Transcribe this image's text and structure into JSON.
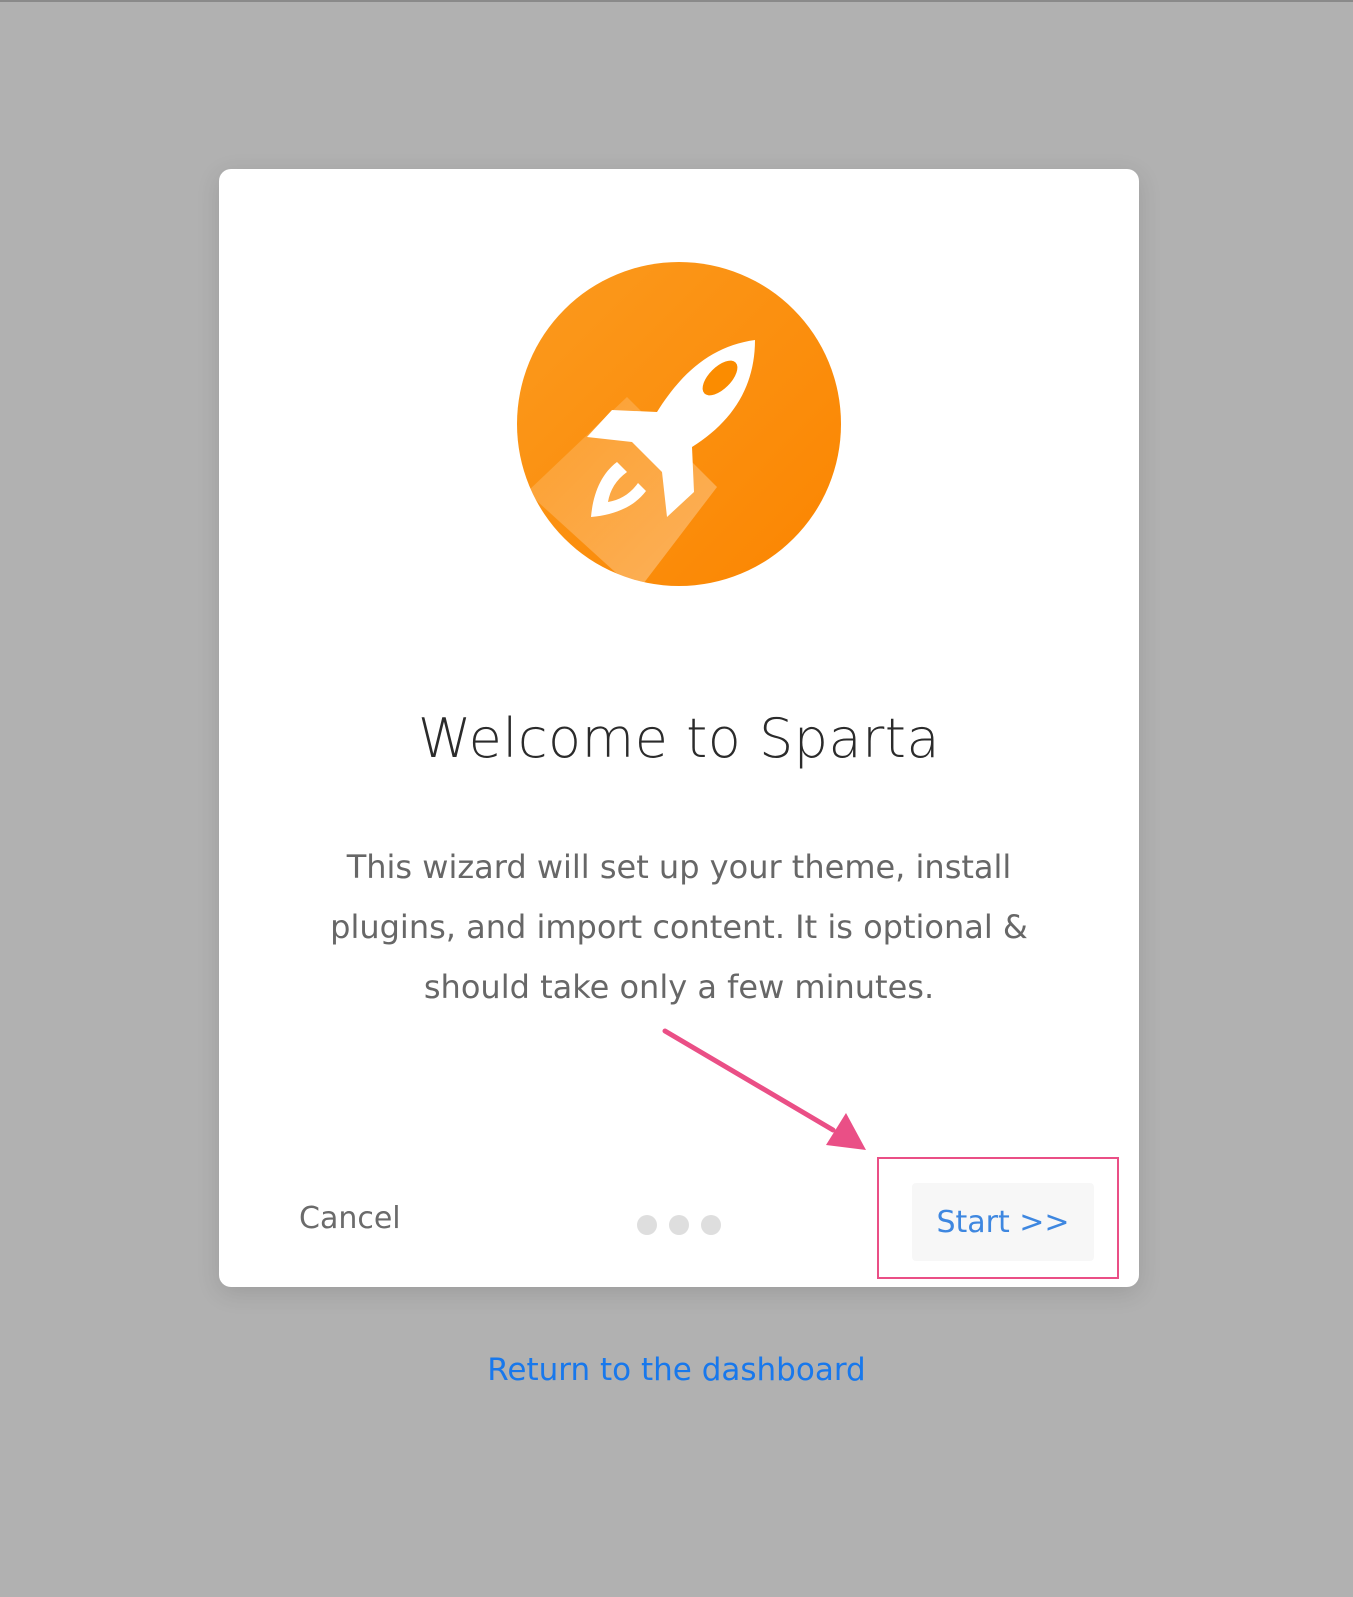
{
  "wizard": {
    "title": "Welcome to Sparta",
    "description": "This wizard will set up your theme, install plugins, and import content. It is optional & should take only a few minutes.",
    "cancel_label": "Cancel",
    "start_label": "Start >>",
    "steps_total": 3,
    "logo_icon": "rocket-icon",
    "logo_color": "#fb8c00"
  },
  "footer": {
    "return_label": "Return to the dashboard"
  },
  "annotation": {
    "highlight_color": "#ea4f86"
  },
  "colors": {
    "background": "#b1b1b1",
    "link": "#1878ec",
    "start_text": "#3e87e0"
  }
}
